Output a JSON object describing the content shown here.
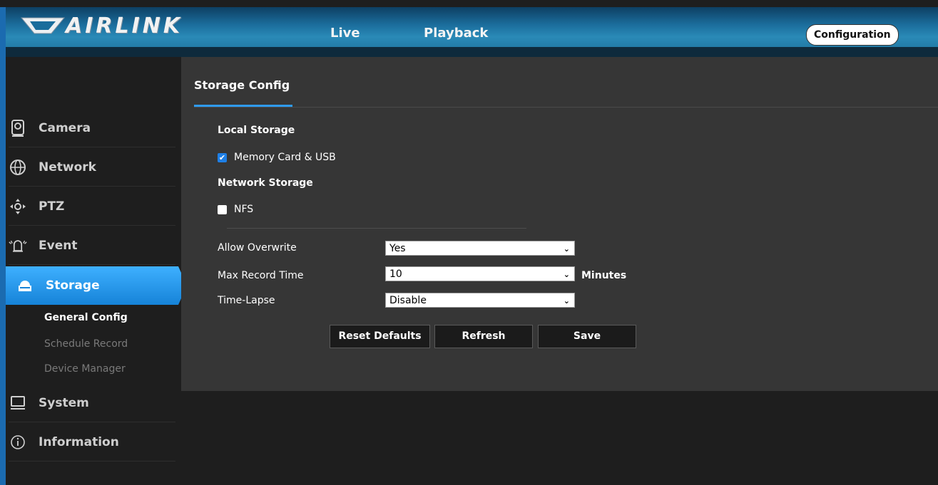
{
  "header": {
    "logo_text": "AIRLINK",
    "nav": {
      "live": "Live",
      "playback": "Playback",
      "configuration": "Configuration"
    }
  },
  "sidebar": {
    "items": [
      {
        "label": "Camera",
        "icon": "camera-icon"
      },
      {
        "label": "Network",
        "icon": "network-icon"
      },
      {
        "label": "PTZ",
        "icon": "ptz-icon"
      },
      {
        "label": "Event",
        "icon": "event-icon"
      },
      {
        "label": "Storage",
        "icon": "storage-icon"
      },
      {
        "label": "System",
        "icon": "system-icon"
      },
      {
        "label": "Information",
        "icon": "information-icon"
      }
    ],
    "storage_sub": [
      "General Config",
      "Schedule Record",
      "Device Manager"
    ]
  },
  "panel": {
    "title": "Storage Config",
    "local_storage_label": "Local Storage",
    "memory_card_label": "Memory Card & USB",
    "memory_card_checked": true,
    "network_storage_label": "Network Storage",
    "nfs_label": "NFS",
    "nfs_checked": false,
    "allow_overwrite_label": "Allow Overwrite",
    "allow_overwrite_value": "Yes",
    "max_record_label": "Max Record Time",
    "max_record_value": "10",
    "max_record_unit": "Minutes",
    "time_lapse_label": "Time-Lapse",
    "time_lapse_value": "Disable",
    "buttons": {
      "reset": "Reset Defaults",
      "refresh": "Refresh",
      "save": "Save"
    }
  },
  "colors": {
    "accent": "#1e8ce8",
    "panel_bg": "#363636",
    "page_bg": "#1e1e1e"
  }
}
